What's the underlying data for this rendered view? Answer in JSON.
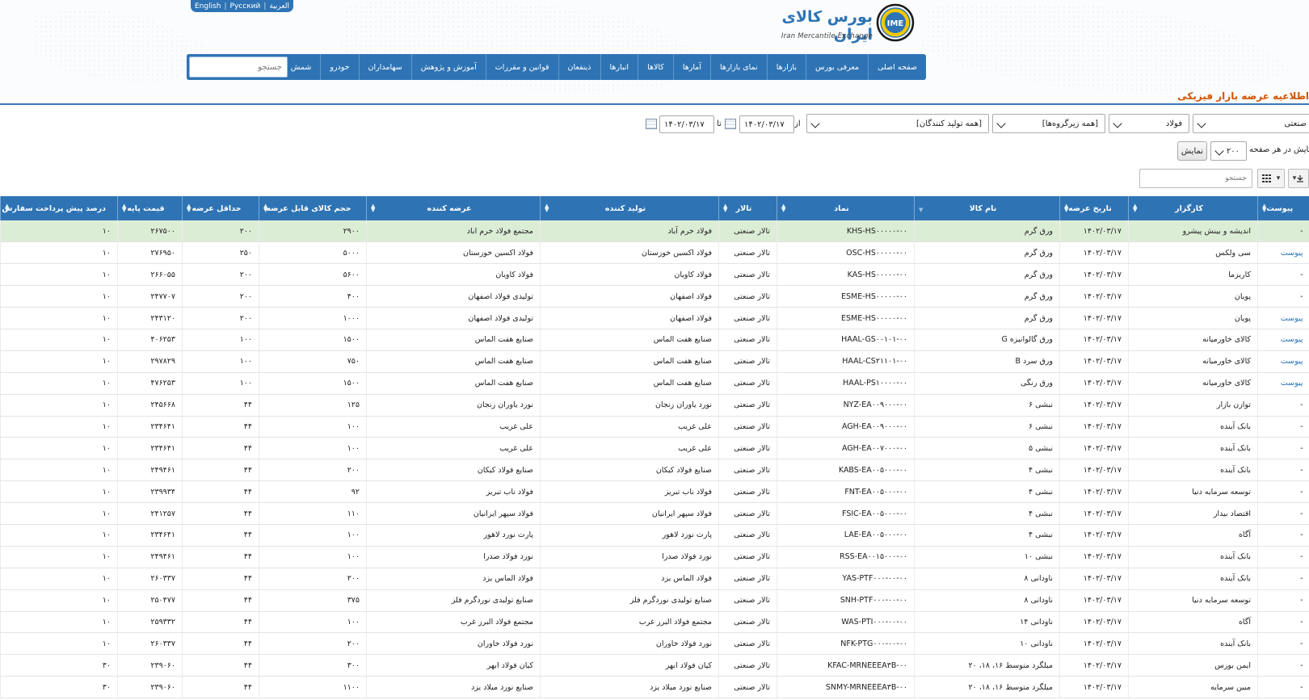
{
  "languages": [
    "العربية",
    "Pусский",
    "English"
  ],
  "brand": {
    "title": "بورس کالای ایران",
    "subtitle": "Iran Mercantile Exchange",
    "logo_text": "IME",
    "accent": "#2e74b5"
  },
  "nav": {
    "items": [
      "صفحه اصلی",
      "معرفی بورس",
      "بازارها",
      "نمای بازارها",
      "آمارها",
      "کالاها",
      "انبارها",
      "ذینفعان",
      "قوانین و مقررات",
      "آموزش و پژوهش",
      "سهامداران",
      "خودرو",
      "شمش طلا"
    ],
    "search_placeholder": "جستجو"
  },
  "page_title": "اطلاعیه عرضه بازار فیزیکی",
  "filters": {
    "market": "صنعتی",
    "group": "فولاد",
    "subgroup": "[همه زیرگروه‌ها]",
    "producer": "[همه تولید کنندگان]",
    "from_label": "از",
    "from_date": "۱۴۰۲/۰۳/۱۷",
    "to_label": "تا",
    "to_date": "۱۴۰۲/۰۳/۱۷",
    "per_page_label": "نمایش در هر صفحه",
    "per_page": "۲۰۰",
    "show_button": "نمایش",
    "grid_search_placeholder": "جستجو"
  },
  "table": {
    "columns": [
      "پیوست",
      "کارگزار",
      "تاریخ عرضه",
      "نام کالا",
      "نماد",
      "تالار",
      "تولید کننده",
      "عرضه کننده",
      "حجم کالای قابل عرضه",
      "حداقل عرضه",
      "قیمت پایه",
      "درصد پیش پرداخت سفارش خرید"
    ],
    "rows": [
      [
        "-",
        "اندیشه و بینش پیشرو",
        "۱۴۰۲/۰۳/۱۷",
        "ورق گرم",
        "KHS-HS۰۰۰۰۰-۰۰",
        "تالار صنعتی",
        "فولاد خرم آباد",
        "مجتمع فولاد خرم اباد",
        "۲۹۰۰",
        "۲۰۰",
        "۲۶۷۵۰۰",
        "۱۰"
      ],
      [
        "پیوست",
        "سی ولکس",
        "۱۴۰۲/۰۳/۱۷",
        "ورق گرم",
        "OSC-HS۰۰۰۰۰-۰۰",
        "تالار صنعتی",
        "فولاد اکسین خوزستان",
        "فولاد اکسین خوزستان",
        "۵۰۰۰",
        "۲۵۰",
        "۲۷۶۹۵۰",
        "۱۰"
      ],
      [
        "-",
        "کاریزما",
        "۱۴۰۲/۰۳/۱۷",
        "ورق گرم",
        "KAS-HS۰۰۰۰۰-۰۰",
        "تالار صنعتی",
        "فولاد کاویان",
        "فولاد کاویان",
        "۵۶۰۰",
        "۲۰۰",
        "۲۶۶۰۵۵",
        "۱۰"
      ],
      [
        "-",
        "پویان",
        "۱۴۰۲/۰۳/۱۷",
        "ورق گرم",
        "ESME-HS۰۰۰۰۰-۰۰",
        "تالار صنعتی",
        "فولاد اصفهان",
        "تولیدی فولاد اصفهان",
        "۴۰۰",
        "۲۰۰",
        "۲۴۷۷۰۷",
        "۱۰"
      ],
      [
        "پیوست",
        "پویان",
        "۱۴۰۲/۰۳/۱۷",
        "ورق گرم",
        "ESME-HS۰۰۰۰۰-۰۰",
        "تالار صنعتی",
        "فولاد اصفهان",
        "تولیدی فولاد اصفهان",
        "۱۰۰۰",
        "۲۰۰",
        "۲۴۳۱۲۰",
        "۱۰"
      ],
      [
        "پیوست",
        "کالای خاورمیانه",
        "۱۴۰۲/۰۳/۱۷",
        "ورق گالوانیزه G",
        "HAAL-GS۰۰۱۰۱-۰۰",
        "تالار صنعتی",
        "صنایع هفت الماس",
        "صنایع هفت الماس",
        "۱۵۰۰",
        "۱۰۰",
        "۴۰۶۲۵۳",
        "۱۰"
      ],
      [
        "پیوست",
        "کالای خاورمیانه",
        "۱۴۰۲/۰۳/۱۷",
        "ورق سرد B",
        "HAAL-CS۲۱۱۰۱-۰۰",
        "تالار صنعتی",
        "صنایع هفت الماس",
        "صنایع هفت الماس",
        "۷۵۰",
        "۱۰۰",
        "۲۹۷۸۲۹",
        "۱۰"
      ],
      [
        "پیوست",
        "کالای خاورمیانه",
        "۱۴۰۲/۰۳/۱۷",
        "ورق رنگی",
        "HAAL-PS۱۰۰۰۰-۰۰",
        "تالار صنعتی",
        "صنایع هفت الماس",
        "صنایع هفت الماس",
        "۱۵۰۰",
        "۱۰۰",
        "۴۷۶۲۵۳",
        "۱۰"
      ],
      [
        "-",
        "توازن بازار",
        "۱۴۰۲/۰۳/۱۷",
        "نبشی ۶",
        "NYZ-EA۰۰۹۰۰۰-۰۰",
        "تالار صنعتی",
        "نورد یاوران زنجان",
        "نورد یاوران زنجان",
        "۱۲۵",
        "۴۴",
        "۲۴۵۶۶۸",
        "۱۰"
      ],
      [
        "-",
        "بانک آینده",
        "۱۴۰۲/۰۳/۱۷",
        "نبشی ۶",
        "AGH-EA۰۰۹۰۰۰-۰۰",
        "تالار صنعتی",
        "علی غریب",
        "علی غریب",
        "۱۰۰",
        "۴۴",
        "۲۳۴۶۴۱",
        "۱۰"
      ],
      [
        "-",
        "بانک آینده",
        "۱۴۰۲/۰۳/۱۷",
        "نبشی ۵",
        "AGH-EA۰۰۷۰۰۰-۰۰",
        "تالار صنعتی",
        "علی غریب",
        "علی غریب",
        "۱۰۰",
        "۴۴",
        "۲۳۴۶۴۱",
        "۱۰"
      ],
      [
        "-",
        "بانک آینده",
        "۱۴۰۲/۰۳/۱۷",
        "نبشی ۴",
        "KABS-EA۰۰۵۰۰۰-۰۰",
        "تالار صنعتی",
        "صنایع فولاد کیکان",
        "صنایع فولاد کیکان",
        "۲۰۰",
        "۴۴",
        "۲۴۹۴۶۱",
        "۱۰"
      ],
      [
        "-",
        "توسعه سرمایه دنیا",
        "۱۴۰۲/۰۳/۱۷",
        "نبشی ۴",
        "FNT-EA۰۰۵۰۰۰-۰۰",
        "تالار صنعتی",
        "فولاد ناب تبریز",
        "فولاد ناب تبریز",
        "۹۲",
        "۴۴",
        "۲۳۹۹۳۴",
        "۱۰"
      ],
      [
        "-",
        "اقتصاد بیدار",
        "۱۴۰۲/۰۳/۱۷",
        "نبشی ۴",
        "FSIC-EA۰۰۵۰۰۰-۰۰",
        "تالار صنعتی",
        "فولاد سپهر ایرانیان",
        "فولاد سپهر ایرانیان",
        "۱۱۰",
        "۴۴",
        "۲۴۱۲۵۷",
        "۱۰"
      ],
      [
        "-",
        "آگاه",
        "۱۴۰۲/۰۳/۱۷",
        "نبشی ۴",
        "LAE-EA۰۰۵۰۰۰-۰۰",
        "تالار صنعتی",
        "پارت نورد لاهور",
        "پارت نورد لاهور",
        "۱۰۰",
        "۴۴",
        "۲۳۴۶۴۱",
        "۱۰"
      ],
      [
        "-",
        "بانک آینده",
        "۱۴۰۲/۰۳/۱۷",
        "نبشی ۱۰",
        "RSS-EA۰۰۱۵۰۰۰-۰۰",
        "تالار صنعتی",
        "نورد فولاد صدرا",
        "نورد فولاد صدرا",
        "۱۰۰",
        "۴۴",
        "۲۴۹۴۶۱",
        "۱۰"
      ],
      [
        "-",
        "بانک آینده",
        "۱۴۰۲/۰۳/۱۷",
        "ناودانی ۸",
        "YAS-PTF۰۰۰-۰۰-۰۰",
        "تالار صنعتی",
        "فولاد الماس یزد",
        "فولاد الماس یزد",
        "۲۰۰",
        "۴۴",
        "۲۶۰۳۳۷",
        "۱۰"
      ],
      [
        "-",
        "توسعه سرمایه دنیا",
        "۱۴۰۲/۰۳/۱۷",
        "ناودانی ۸",
        "SNH-PTF۰۰۰-۰۰-۰۰",
        "تالار صنعتی",
        "صنایع تولیدی نوردگرم فلز",
        "صنایع تولیدی نوردگرم فلز",
        "۳۷۵",
        "۴۴",
        "۲۵۰۴۷۷",
        "۱۰"
      ],
      [
        "-",
        "آگاه",
        "۱۴۰۲/۰۳/۱۷",
        "ناودانی ۱۴",
        "WAS-PTI۰۰۰-۰۰-۰۰",
        "تالار صنعتی",
        "مجتمع فولاد البرز غرب",
        "مجتمع فولاد البرز غرب",
        "۱۰۰",
        "۴۴",
        "۲۵۹۳۳۲",
        "۱۰"
      ],
      [
        "-",
        "بانک آینده",
        "۱۴۰۲/۰۳/۱۷",
        "ناودانی ۱۰",
        "NFK-PTG۰۰۰-۰۰-۰۰",
        "تالار صنعتی",
        "نورد فولاد خاوران",
        "نورد فولاد خاوران",
        "۲۰۰",
        "۴۴",
        "۲۶۰۳۳۷",
        "۱۰"
      ],
      [
        "-",
        "ایمن بورس",
        "۱۴۰۲/۰۳/۱۷",
        "میلگرد متوسط ۱۶، ۱۸، ۲۰",
        "KFAC-MRNEEEA۳B-۰۰",
        "تالار صنعتی",
        "کیان فولاد ابهر",
        "کیان فولاد ابهر",
        "۳۰۰",
        "۴۴",
        "۲۳۹۰۶۰",
        "۳۰"
      ],
      [
        "-",
        "مبین سرمایه",
        "۱۴۰۲/۰۳/۱۷",
        "میلگرد متوسط ۱۶، ۱۸، ۲۰",
        "SNMY-MRNEEEA۳B-۰۰",
        "تالار صنعتی",
        "صنایع نورد میلاد یزد",
        "صنایع نورد میلاد یزد",
        "۱۱۰۰",
        "۴۴",
        "۲۳۹۰۶۰",
        "۳۰"
      ]
    ]
  }
}
